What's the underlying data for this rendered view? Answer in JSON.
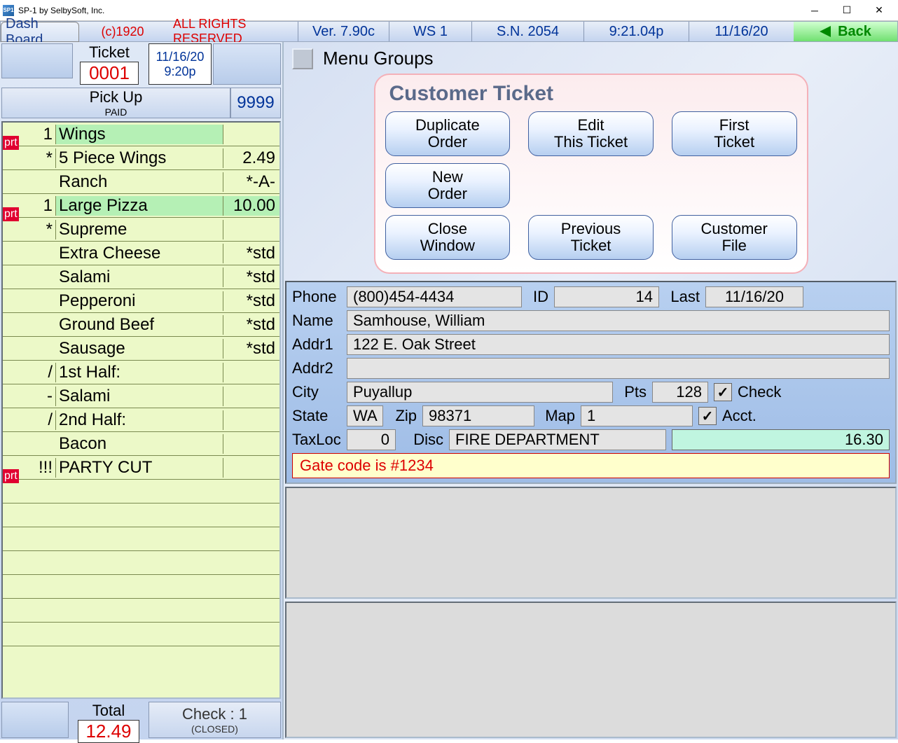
{
  "window": {
    "title": "SP-1 by SelbySoft, Inc.",
    "icon_text": "SP1"
  },
  "topbar": {
    "dashboard": "Dash Board",
    "copyright": "(c)1920",
    "rights": "ALL RIGHTS RESERVED",
    "version": "Ver. 7.90c",
    "ws": "WS  1",
    "sn": "S.N. 2054",
    "time": "9:21.04p",
    "date": "11/16/20",
    "back": "Back"
  },
  "ticket_header": {
    "label": "Ticket",
    "number": "0001",
    "date": "11/16/20",
    "time": "9:20p"
  },
  "pickup": {
    "label": "Pick Up",
    "status": "PAID",
    "number": "9999"
  },
  "order_lines": [
    {
      "badge": "prt",
      "qty": "1",
      "desc": "Wings",
      "price": "",
      "highlight": true
    },
    {
      "badge": "",
      "qty": "*",
      "desc": "5 Piece Wings",
      "price": "2.49"
    },
    {
      "badge": "",
      "qty": "",
      "desc": "Ranch",
      "price": "*-A-"
    },
    {
      "badge": "prt",
      "qty": "1",
      "desc": "Large Pizza",
      "price": "10.00",
      "highlight": true
    },
    {
      "badge": "",
      "qty": "*",
      "desc": "Supreme",
      "price": ""
    },
    {
      "badge": "",
      "qty": "",
      "desc": "Extra Cheese",
      "price": "*std"
    },
    {
      "badge": "",
      "qty": "",
      "desc": "Salami",
      "price": "*std"
    },
    {
      "badge": "",
      "qty": "",
      "desc": "Pepperoni",
      "price": "*std"
    },
    {
      "badge": "",
      "qty": "",
      "desc": "Ground Beef",
      "price": "*std"
    },
    {
      "badge": "",
      "qty": "",
      "desc": "Sausage",
      "price": "*std"
    },
    {
      "badge": "",
      "qty": "/",
      "desc": "1st Half:",
      "price": ""
    },
    {
      "badge": "",
      "qty": "-",
      "desc": "Salami",
      "price": ""
    },
    {
      "badge": "",
      "qty": "/",
      "desc": "2nd Half:",
      "price": ""
    },
    {
      "badge": "",
      "qty": "",
      "desc": "Bacon",
      "price": ""
    },
    {
      "badge": "prt",
      "qty": "!!!",
      "desc": "PARTY CUT",
      "price": ""
    },
    {
      "empty": true
    },
    {
      "empty": true
    },
    {
      "empty": true
    },
    {
      "empty": true
    },
    {
      "empty": true
    },
    {
      "empty": true
    },
    {
      "empty": true
    }
  ],
  "totals": {
    "total_label": "Total",
    "total_value": "12.49",
    "check_label": "Check :  1",
    "check_status": "(CLOSED)"
  },
  "menu_groups_label": "Menu Groups",
  "card": {
    "title": "Customer Ticket",
    "buttons": {
      "dup1": "Duplicate",
      "dup2": "Order",
      "edit1": "Edit",
      "edit2": "This Ticket",
      "first1": "First",
      "first2": "Ticket",
      "new1": "New",
      "new2": "Order",
      "close1": "Close",
      "close2": "Window",
      "prev1": "Previous",
      "prev2": "Ticket",
      "file1": "Customer",
      "file2": "File"
    }
  },
  "customer": {
    "phone_lbl": "Phone",
    "phone": "(800)454-4434",
    "id_lbl": "ID",
    "id": "14",
    "last_lbl": "Last",
    "last": "11/16/20",
    "name_lbl": "Name",
    "name": "Samhouse, William",
    "addr1_lbl": "Addr1",
    "addr1": "122 E. Oak Street",
    "addr2_lbl": "Addr2",
    "addr2": "",
    "city_lbl": "City",
    "city": "Puyallup",
    "pts_lbl": "Pts",
    "pts": "128",
    "check_lbl": "Check",
    "state_lbl": "State",
    "state": "WA",
    "zip_lbl": "Zip",
    "zip": "98371",
    "map_lbl": "Map",
    "map": "1",
    "acct_lbl": "Acct.",
    "taxloc_lbl": "TaxLoc",
    "taxloc": "0",
    "disc_lbl": "Disc",
    "disc": "FIRE DEPARTMENT",
    "disc_amt": "16.30",
    "note": "Gate code is #1234",
    "checkmark": "✓"
  }
}
